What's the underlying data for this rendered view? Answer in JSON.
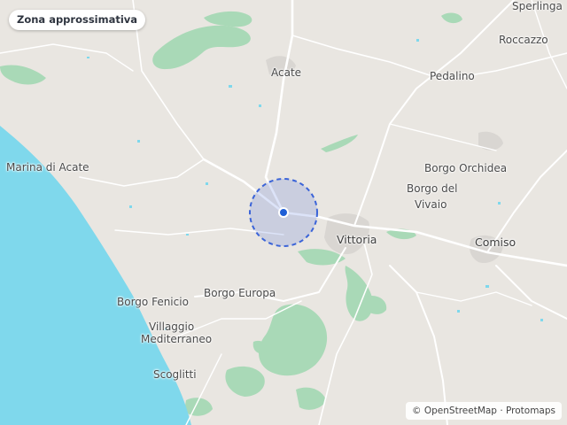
{
  "map": {
    "badge_label": "Zona approssimativa",
    "attribution": {
      "osm": "© OpenStreetMap",
      "separator": " · ",
      "tiles": "Protomaps"
    },
    "places": {
      "sperlinga": "Sperlinga",
      "roccazzo": "Roccazzo",
      "acate": "Acate",
      "pedalino": "Pedalino",
      "marina_di_acate": "Marina di Acate",
      "borgo_orchidea": "Borgo Orchidea",
      "borgo_del": "Borgo del",
      "vivaio": "Vivaio",
      "vittoria": "Vittoria",
      "comiso": "Comiso",
      "borgo_fenicio": "Borgo Fenicio",
      "borgo_europa": "Borgo Europa",
      "villaggio": "Villaggio",
      "mediterraneo": "Mediterraneo",
      "scoglitti": "Scoglitti"
    },
    "colors": {
      "land": "#e9e6e1",
      "sea": "#7fd8ec",
      "park": "#a9d9b7",
      "road": "#ffffff",
      "accuracy": "#3b64d8",
      "marker": "#1f5fd6"
    }
  }
}
